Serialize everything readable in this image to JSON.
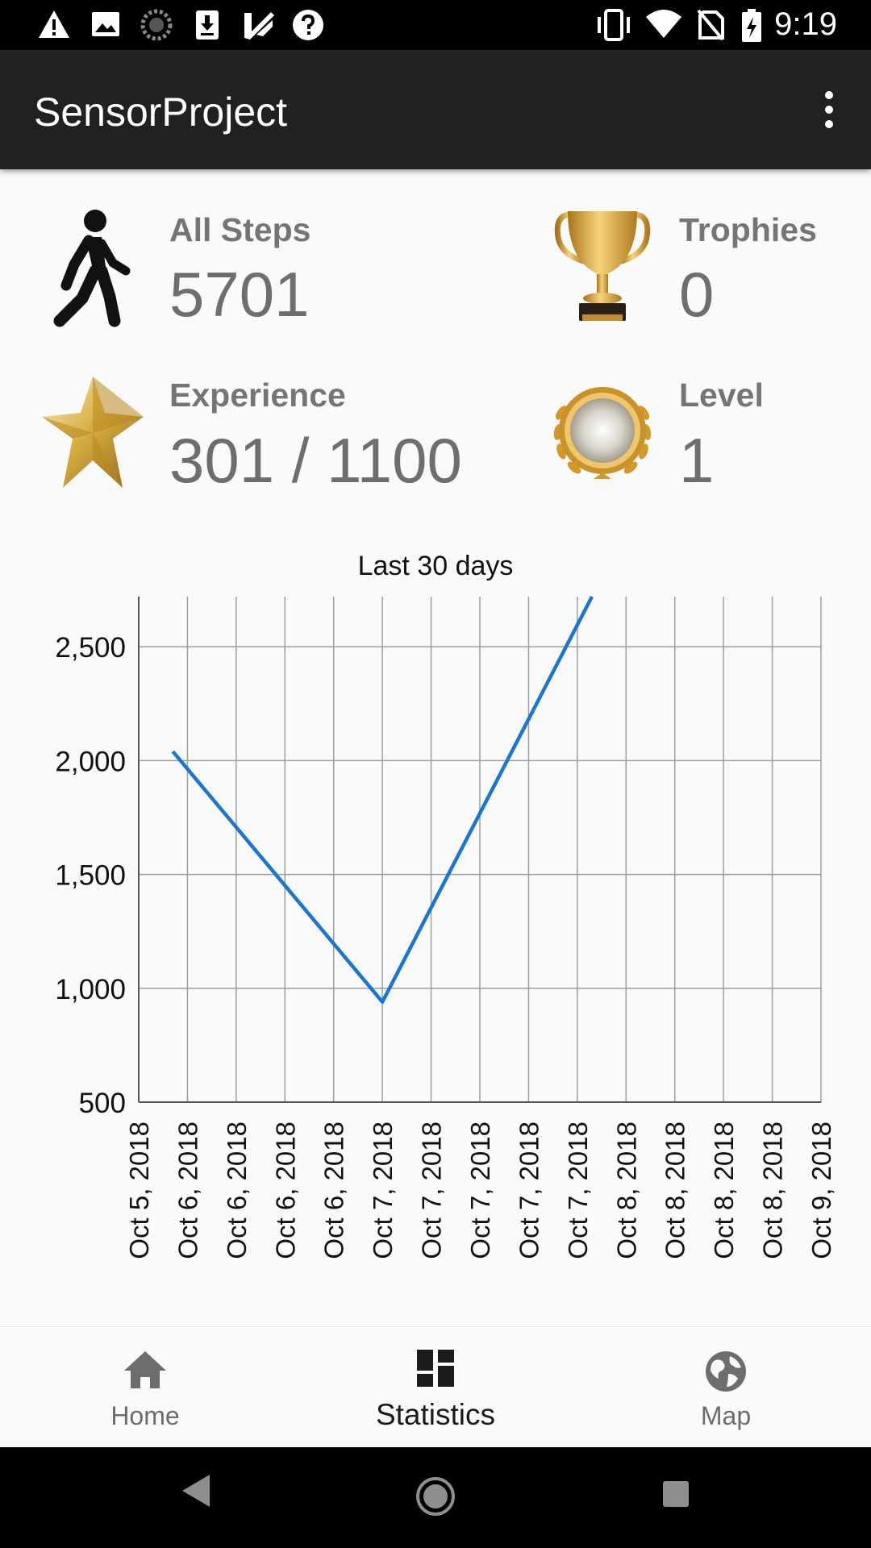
{
  "status_bar": {
    "time": "9:19",
    "left_icons": [
      "warning-icon",
      "image-icon",
      "spinner-icon",
      "download-icon",
      "task-icon",
      "help-icon"
    ],
    "right_icons": [
      "vibrate-icon",
      "wifi-icon",
      "no-sim-icon",
      "battery-charging-icon"
    ]
  },
  "app_bar": {
    "title": "SensorProject"
  },
  "stats": {
    "steps": {
      "label": "All Steps",
      "value": "5701"
    },
    "trophies": {
      "label": "Trophies",
      "value": "0"
    },
    "experience": {
      "label": "Experience",
      "value": "301 / 1100"
    },
    "level": {
      "label": "Level",
      "value": "1"
    }
  },
  "chart_data": {
    "type": "line",
    "title": "Last 30 days",
    "xlabel": "",
    "ylabel": "",
    "categories": [
      "Oct 5, 2018",
      "Oct 6, 2018",
      "Oct 6, 2018",
      "Oct 6, 2018",
      "Oct 6, 2018",
      "Oct 7, 2018",
      "Oct 7, 2018",
      "Oct 7, 2018",
      "Oct 7, 2018",
      "Oct 7, 2018",
      "Oct 8, 2018",
      "Oct 8, 2018",
      "Oct 8, 2018",
      "Oct 8, 2018",
      "Oct 9, 2018"
    ],
    "yticks": [
      "500",
      "1,000",
      "1,500",
      "2,000",
      "2,500"
    ],
    "ylim": [
      500,
      2720
    ],
    "series": [
      {
        "points": [
          {
            "x": 0.7,
            "y": 2040
          },
          {
            "x": 5,
            "y": 940
          },
          {
            "x": 9.3,
            "y": 2720
          }
        ]
      }
    ],
    "line_color": "#1976d2",
    "grid": true
  },
  "bottom_nav": {
    "items": [
      {
        "label": "Home",
        "icon": "home-icon",
        "active": false
      },
      {
        "label": "Statistics",
        "icon": "dashboard-icon",
        "active": true
      },
      {
        "label": "Map",
        "icon": "globe-icon",
        "active": false
      }
    ]
  },
  "system_nav": [
    "back-icon",
    "home-circle-icon",
    "recents-icon"
  ]
}
